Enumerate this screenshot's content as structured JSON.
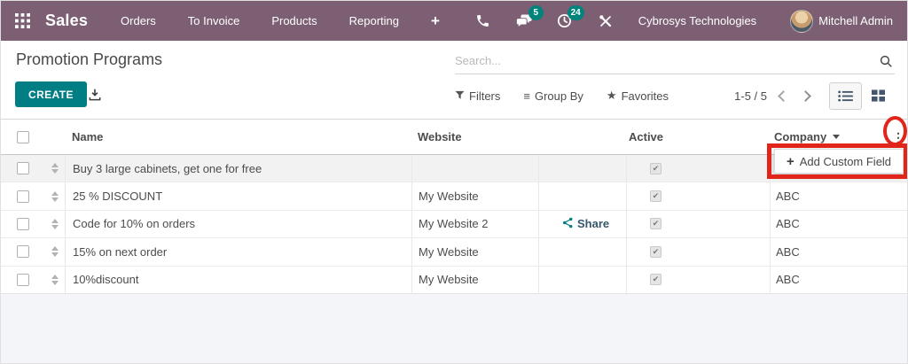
{
  "colors": {
    "navbar_bg": "#7d5f73",
    "accent_teal": "#017e84",
    "badge_teal": "#01837d",
    "annotation_red": "#e1251b",
    "text_dark": "#4c4c4c"
  },
  "navbar": {
    "brand": "Sales",
    "menu": [
      "Orders",
      "To Invoice",
      "Products",
      "Reporting"
    ],
    "plus": "+",
    "badges": {
      "messages": "5",
      "activities": "24"
    },
    "company": "Cybrosys Technologies",
    "user": "Mitchell Admin"
  },
  "control_panel": {
    "title": "Promotion Programs",
    "search_placeholder": "Search...",
    "create_label": "CREATE",
    "filters_label": "Filters",
    "group_by_label": "Group By",
    "favorites_label": "Favorites",
    "pager": "1-5 / 5"
  },
  "icons": {
    "group_by_glyph": "≡",
    "favorites_glyph": "★",
    "column_options_glyph": "⋮"
  },
  "dropdown": {
    "plus": "+",
    "label": "Add Custom Field"
  },
  "table": {
    "headers": {
      "name": "Name",
      "website": "Website",
      "active": "Active",
      "company": "Company"
    },
    "rows": [
      {
        "name": "Buy 3 large cabinets, get one for free",
        "website": "",
        "share_label": "",
        "active": true,
        "company": ""
      },
      {
        "name": "25 % DISCOUNT",
        "website": "My Website",
        "share_label": "",
        "active": true,
        "company": "ABC"
      },
      {
        "name": "Code for 10% on orders",
        "website": "My Website 2",
        "share_label": "Share",
        "active": true,
        "company": "ABC"
      },
      {
        "name": "15% on next order",
        "website": "My Website",
        "share_label": "",
        "active": true,
        "company": "ABC"
      },
      {
        "name": "10%discount",
        "website": "My Website",
        "share_label": "",
        "active": true,
        "company": "ABC"
      }
    ]
  }
}
